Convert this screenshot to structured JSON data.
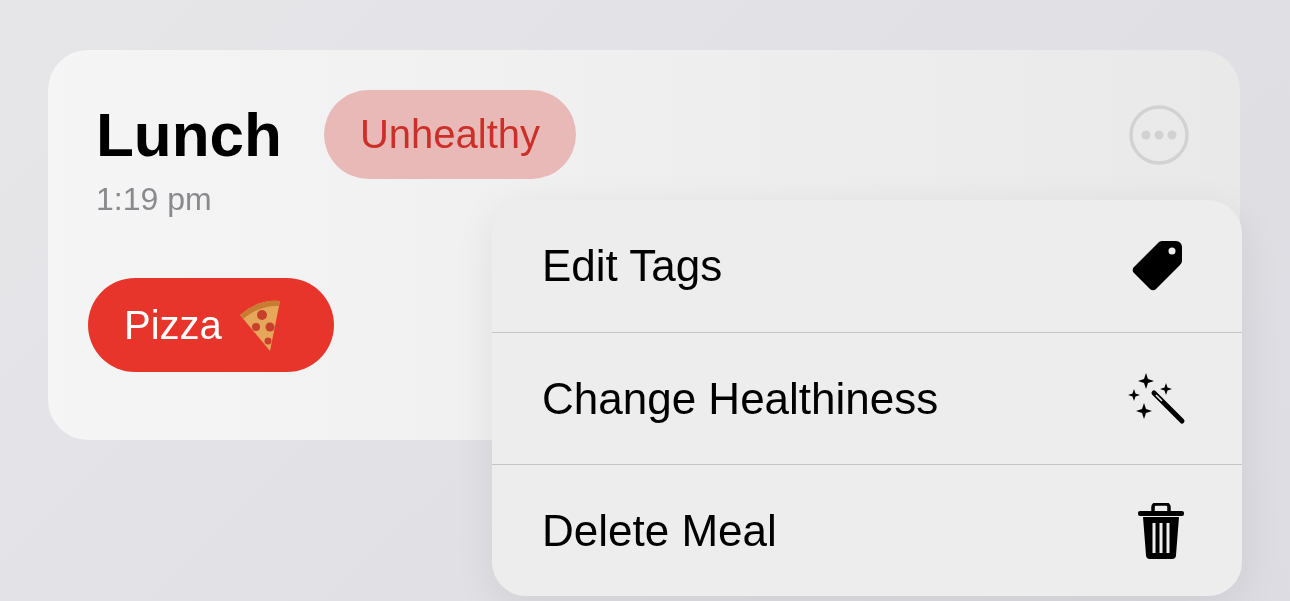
{
  "meal": {
    "title": "Lunch",
    "health_tag": {
      "label": "Unhealthy",
      "color": "#e8b9b7"
    },
    "time": "1:19 pm",
    "food_tags": [
      {
        "label": "Pizza",
        "kind": "pizza",
        "color": "#e8352c"
      }
    ]
  },
  "menu": {
    "items": [
      {
        "label": "Edit Tags",
        "kind": "tag"
      },
      {
        "label": "Change Healthiness",
        "kind": "wand"
      },
      {
        "label": "Delete Meal",
        "kind": "trash"
      }
    ]
  }
}
